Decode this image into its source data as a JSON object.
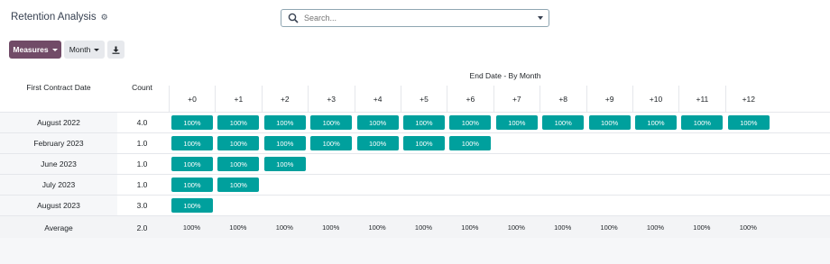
{
  "header": {
    "title": "Retention Analysis",
    "search_placeholder": "Search..."
  },
  "toolbar": {
    "measures_label": "Measures",
    "month_label": "Month"
  },
  "table": {
    "first_col_header": "First Contract Date",
    "count_header": "Count",
    "group_header": "End Date - By Month",
    "period_headers": [
      "+0",
      "+1",
      "+2",
      "+3",
      "+4",
      "+5",
      "+6",
      "+7",
      "+8",
      "+9",
      "+10",
      "+11",
      "+12"
    ],
    "rows": [
      {
        "date": "August 2022",
        "count": "4.0",
        "cells": [
          "100%",
          "100%",
          "100%",
          "100%",
          "100%",
          "100%",
          "100%",
          "100%",
          "100%",
          "100%",
          "100%",
          "100%",
          "100%"
        ]
      },
      {
        "date": "February 2023",
        "count": "1.0",
        "cells": [
          "100%",
          "100%",
          "100%",
          "100%",
          "100%",
          "100%",
          "100%"
        ]
      },
      {
        "date": "June 2023",
        "count": "1.0",
        "cells": [
          "100%",
          "100%",
          "100%"
        ]
      },
      {
        "date": "July 2023",
        "count": "1.0",
        "cells": [
          "100%",
          "100%"
        ]
      },
      {
        "date": "August 2023",
        "count": "3.0",
        "cells": [
          "100%"
        ]
      }
    ],
    "average": {
      "label": "Average",
      "count": "2.0",
      "cells": [
        "100%",
        "100%",
        "100%",
        "100%",
        "100%",
        "100%",
        "100%",
        "100%",
        "100%",
        "100%",
        "100%",
        "100%",
        "100%"
      ]
    }
  },
  "colors": {
    "pill": "#00a09d",
    "measures_btn": "#714b67"
  }
}
